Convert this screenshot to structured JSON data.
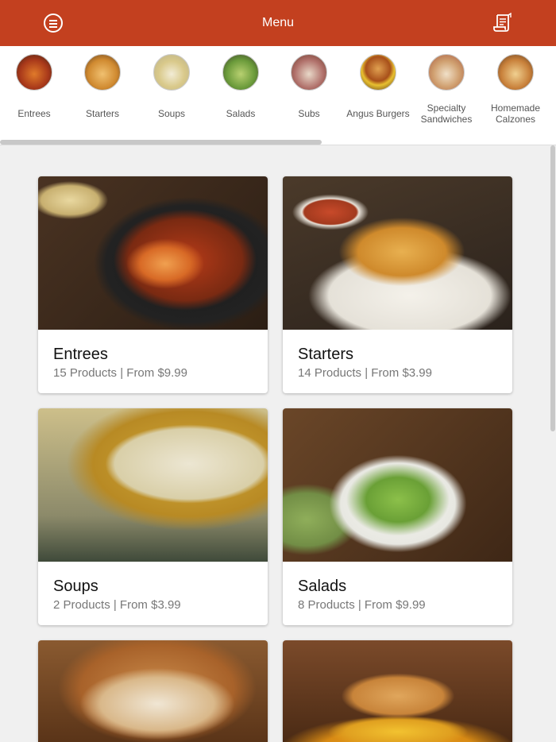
{
  "header": {
    "title": "Menu",
    "color": "#c3401f",
    "menu_icon": "hamburger-circle-icon",
    "receipt_icon": "receipt-icon"
  },
  "categories": [
    {
      "label": "Entrees"
    },
    {
      "label": "Starters"
    },
    {
      "label": "Soups"
    },
    {
      "label": "Salads"
    },
    {
      "label": "Subs"
    },
    {
      "label": "Angus Burgers"
    },
    {
      "label": "Specialty\nSandwiches"
    },
    {
      "label": "Homemade\nCalzones"
    }
  ],
  "cards": [
    {
      "name": "Entrees",
      "meta": "15 Products | From $9.99"
    },
    {
      "name": "Starters",
      "meta": "14 Products | From $3.99"
    },
    {
      "name": "Soups",
      "meta": "2 Products | From $3.99"
    },
    {
      "name": "Salads",
      "meta": "8 Products | From $9.99"
    }
  ]
}
